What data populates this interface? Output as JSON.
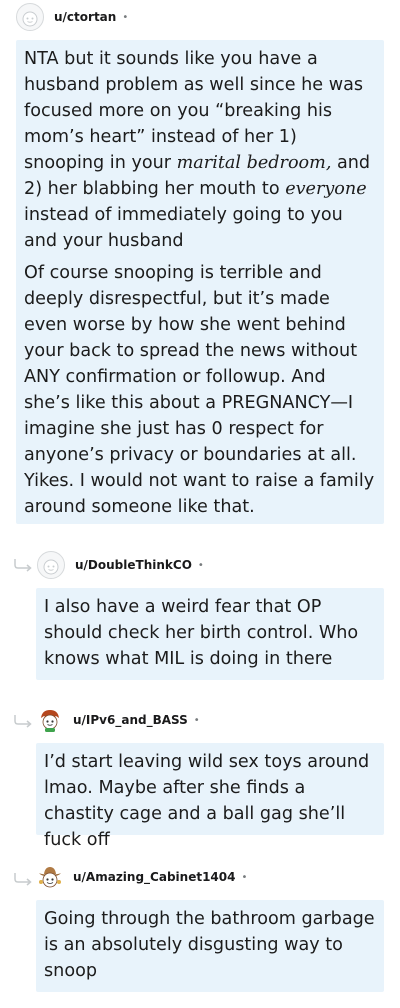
{
  "comments": [
    {
      "username": "u/ctortan",
      "separator": "•",
      "avatar_icon": "snoo-avatar-icon",
      "paragraphs": [
        {
          "parts": [
            {
              "text": "NTA but it sounds like you have a husband problem as well since he was focused more on you “breaking his mom’s heart” instead of her 1) snooping in your "
            },
            {
              "text": "marital bedroom,",
              "italic": true
            },
            {
              "text": " and 2) her blabbing her mouth to "
            },
            {
              "text": "everyone",
              "italic": true
            },
            {
              "text": " instead of immediately going to you and your husband"
            }
          ]
        },
        {
          "parts": [
            {
              "text": "Of course snooping is terrible and deeply disrespectful, but it’s made even worse by how she went behind your back to spread the news without ANY confirmation or followup. And she’s like this about a PREGNANCY—I imagine she just has 0 respect for anyone’s privacy or boundaries at all. Yikes. I would not want to raise a family around someone like that."
            }
          ]
        }
      ]
    },
    {
      "username": "u/DoubleThinkCO",
      "separator": "•",
      "avatar_icon": "snoo-avatar-icon",
      "text": "I also have a weird fear that OP should check her birth control. Who knows what MIL is doing in there"
    },
    {
      "username": "u/IPv6_and_BASS",
      "separator": "•",
      "avatar_icon": "snoo-red-hair-avatar-icon",
      "text": "I’d start leaving wild sex toys around lmao. Maybe after she finds a chastity cage and a ball gag she’ll fuck off"
    },
    {
      "username": "u/Amazing_Cabinet1404",
      "separator": "•",
      "avatar_icon": "snoo-cowboy-avatar-icon",
      "text": "Going through the bathroom garbage is an absolutely disgusting way to snoop"
    }
  ],
  "icons": {
    "reply_arrow": "reply-arrow-icon"
  },
  "colors": {
    "bubble_background": "#e8f3fb",
    "username_text": "#1a1a1b",
    "reply_arrow": "#c7cbcd"
  }
}
